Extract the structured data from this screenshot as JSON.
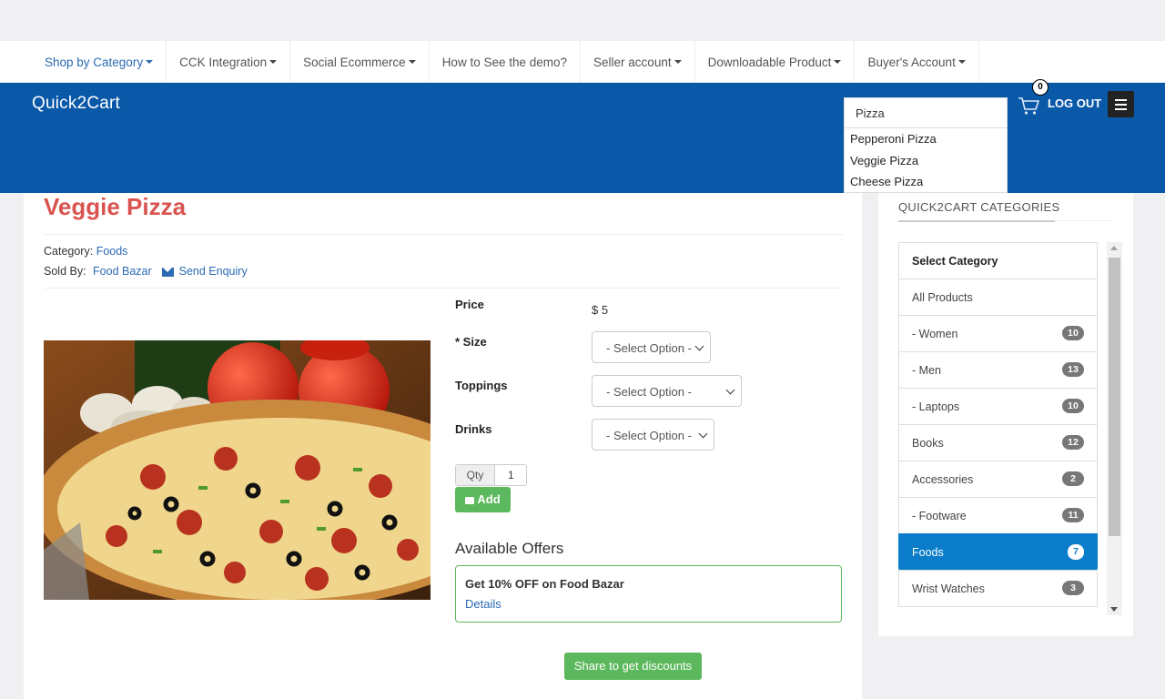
{
  "topnav": {
    "items": [
      {
        "label": "Shop by Category",
        "dropdown": true
      },
      {
        "label": "CCK Integration",
        "dropdown": true
      },
      {
        "label": "Social Ecommerce",
        "dropdown": true
      },
      {
        "label": "How to See the demo?",
        "dropdown": false
      },
      {
        "label": "Seller account",
        "dropdown": true
      },
      {
        "label": "Downloadable Product",
        "dropdown": true
      },
      {
        "label": "Buyer's Account",
        "dropdown": true
      }
    ]
  },
  "header": {
    "brand": "Quick2Cart",
    "search": {
      "value": "Pizza",
      "suggestions": [
        "Pepperoni Pizza",
        "Veggie Pizza",
        "Cheese Pizza"
      ]
    },
    "cart_count": "0",
    "logout_label": "LOG OUT",
    "bg_color": "#0a58a8"
  },
  "product": {
    "title": "Veggie Pizza",
    "category_label": "Category:",
    "category": "Foods",
    "sold_by_label": "Sold By:",
    "seller": "Food Bazar",
    "enquiry": "Send Enquiry",
    "price_label": "Price",
    "price": "$ 5",
    "size_label": "* Size",
    "size_value": "- Select Option -",
    "toppings_label": "Toppings",
    "toppings_value": "- Select Option -",
    "drinks_label": "Drinks",
    "drinks_value": "- Select Option -",
    "qty_label": "Qty",
    "qty_value": "1",
    "add_label": "Add",
    "offers_title": "Available Offers",
    "offer_text": "Get 10% OFF on Food Bazar",
    "offer_link": "Details",
    "share_label": "Share to get discounts"
  },
  "sidebar": {
    "title": "QUICK2CART CATEGORIES",
    "items": [
      {
        "label": "Select Category",
        "count": ""
      },
      {
        "label": "All Products",
        "count": ""
      },
      {
        "label": "- Women",
        "count": "10"
      },
      {
        "label": "- Men",
        "count": "13"
      },
      {
        "label": "- Laptops",
        "count": "10"
      },
      {
        "label": "Books",
        "count": "12"
      },
      {
        "label": "Accessories",
        "count": "2"
      },
      {
        "label": "- Footware",
        "count": "11"
      },
      {
        "label": "Foods",
        "count": "7"
      },
      {
        "label": "Wrist Watches",
        "count": "3"
      }
    ]
  }
}
